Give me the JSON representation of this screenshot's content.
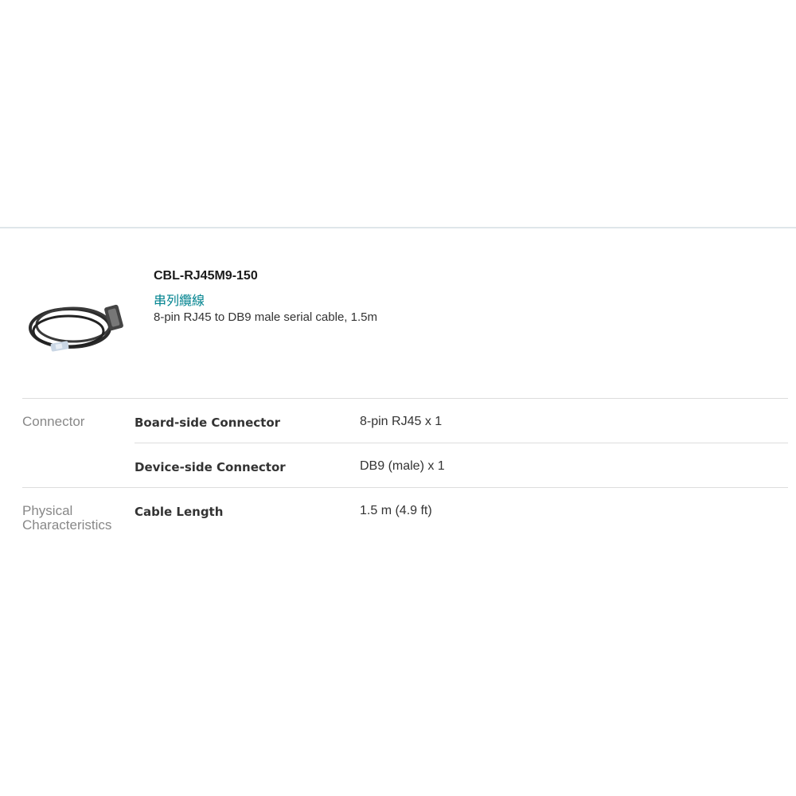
{
  "product": {
    "image_icon": "serial-cable-photo",
    "title": "CBL-RJ45M9-150",
    "subtitle": "串列纜線",
    "description": "8-pin RJ45 to DB9 male serial cable, 1.5m"
  },
  "specs": [
    {
      "group": "Connector",
      "rows": [
        {
          "label": "Board-side Connector",
          "value": "8-pin RJ45 x 1"
        },
        {
          "label": "Device-side Connector",
          "value": "DB9 (male) x 1"
        }
      ]
    },
    {
      "group": "Physical Characteristics",
      "rows": [
        {
          "label": "Cable Length",
          "value": "1.5 m (4.9 ft)"
        }
      ]
    }
  ],
  "colors": {
    "subtitle_accent": "#00838f",
    "divider": "#dddddd"
  }
}
